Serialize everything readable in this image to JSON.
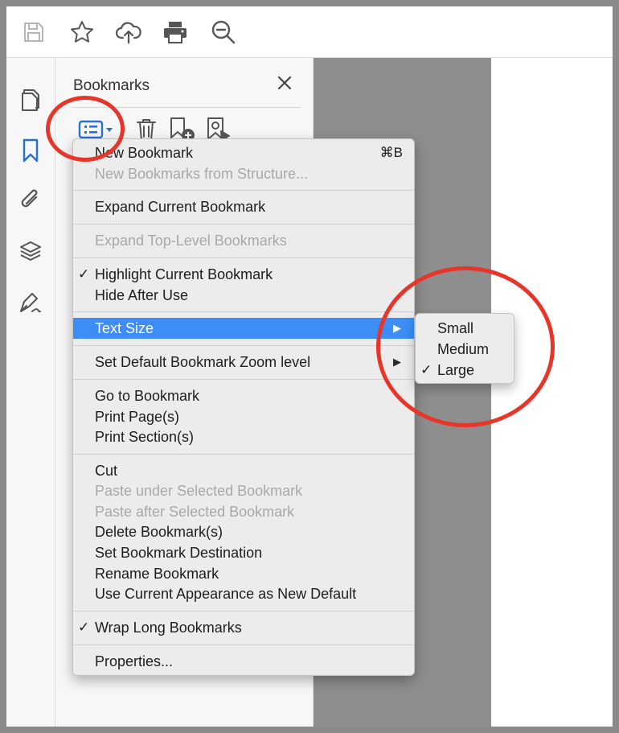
{
  "toolbar": {
    "icons": [
      "save-icon",
      "star-icon",
      "cloud-upload-icon",
      "print-icon",
      "zoom-out-icon"
    ]
  },
  "left_rail": {
    "icons": [
      "pages-icon",
      "bookmark-icon",
      "attachment-icon",
      "layers-icon",
      "signature-icon"
    ]
  },
  "panel": {
    "title": "Bookmarks",
    "close": "✕",
    "tools": [
      "options-menu-icon",
      "delete-icon",
      "new-bookmark-icon",
      "bookmark-from-selection-icon"
    ]
  },
  "menu": {
    "new_bookmark": "New Bookmark",
    "new_bookmark_shortcut": "⌘B",
    "new_from_structure": "New Bookmarks from Structure...",
    "expand_current": "Expand Current Bookmark",
    "expand_top_level": "Expand Top-Level Bookmarks",
    "highlight_current": "Highlight Current Bookmark",
    "hide_after_use": "Hide After Use",
    "text_size": "Text Size",
    "set_default_zoom": "Set Default Bookmark Zoom level",
    "go_to_bookmark": "Go to Bookmark",
    "print_pages": "Print Page(s)",
    "print_sections": "Print Section(s)",
    "cut": "Cut",
    "paste_under": "Paste under Selected Bookmark",
    "paste_after": "Paste after Selected Bookmark",
    "delete_bookmarks": "Delete Bookmark(s)",
    "set_destination": "Set Bookmark Destination",
    "rename": "Rename Bookmark",
    "use_current_appearance": "Use Current Appearance as New Default",
    "wrap_long": "Wrap Long Bookmarks",
    "properties": "Properties...",
    "check": "✓",
    "submenu_arrow": "▶"
  },
  "text_size_submenu": {
    "small": "Small",
    "medium": "Medium",
    "large": "Large",
    "selected": "Large",
    "check": "✓"
  },
  "colors": {
    "highlight": "#3d8df7",
    "annotation_ring": "#e8352a",
    "disabled_text": "#a8a8a8"
  }
}
